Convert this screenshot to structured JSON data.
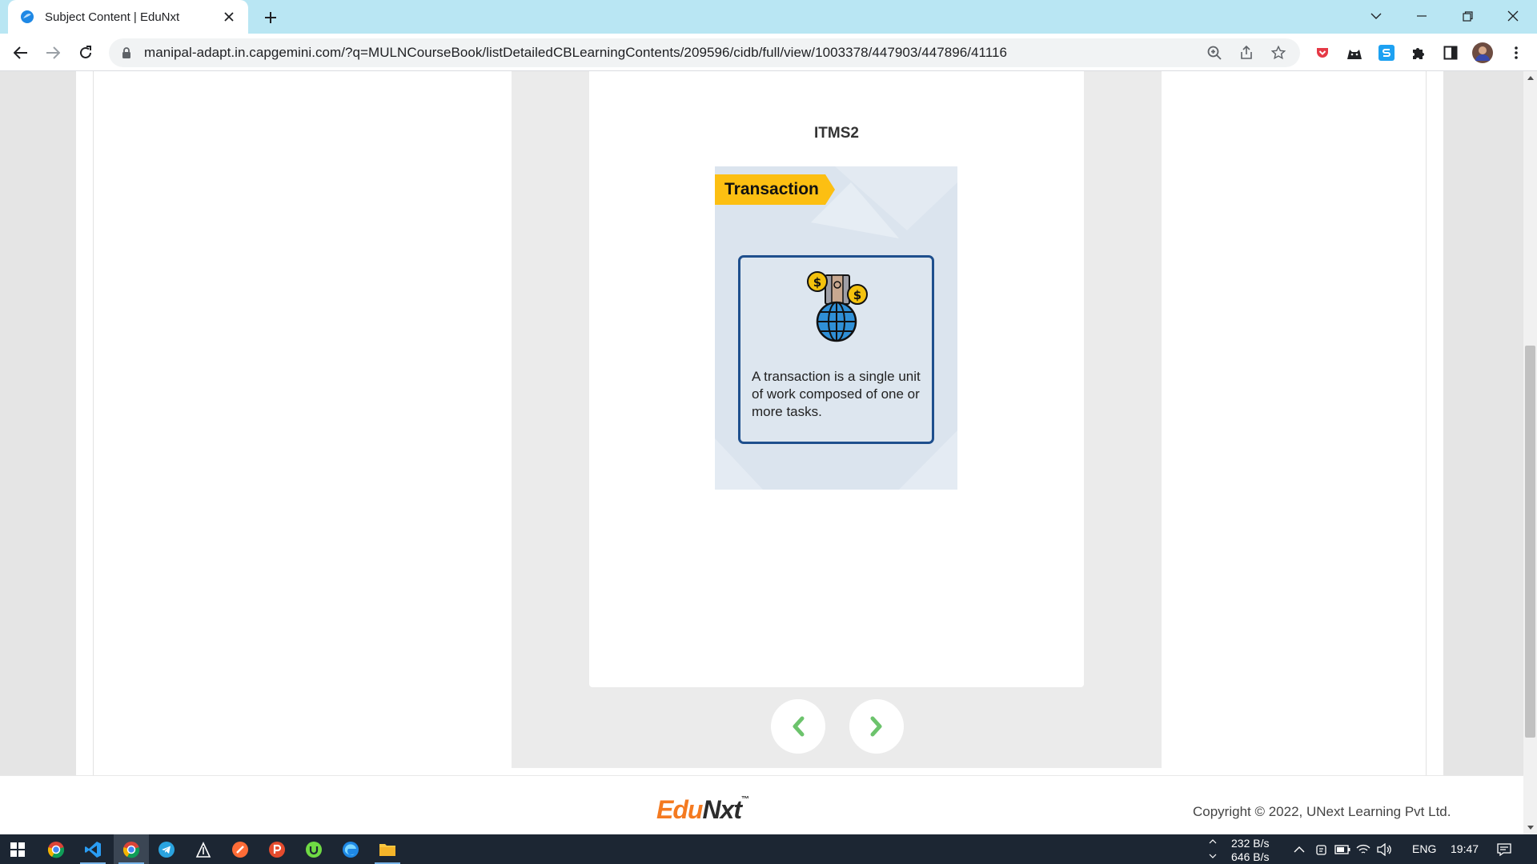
{
  "browser": {
    "tab_title": "Subject Content | EduNxt",
    "url": "manipal-adapt.in.capgemini.com/?q=MULNCourseBook/listDetailedCBLearningContents/209596/cidb/full/view/1003378/447903/447896/41116"
  },
  "slide": {
    "title": "ITMS2",
    "card": {
      "tag": "Transaction",
      "icon": "globe-money-icon",
      "text": "A transaction  is a single unit of work composed of one or more  tasks."
    }
  },
  "footer": {
    "brand_part1": "Edu",
    "brand_part2": "Nxt",
    "brand_tm": "™",
    "copyright": "Copyright © 2022, UNext Learning Pvt Ltd."
  },
  "taskbar": {
    "net_up": "232 B/s",
    "net_down": "646 B/s",
    "language": "ENG",
    "time": "19:47"
  },
  "colors": {
    "tabstrip": "#b9e6f3",
    "tag": "#fcbf12",
    "card_border": "#1e4f8d",
    "arrow": "#6cc36c",
    "brand_orange": "#f47a20",
    "taskbar": "#1c2633"
  }
}
